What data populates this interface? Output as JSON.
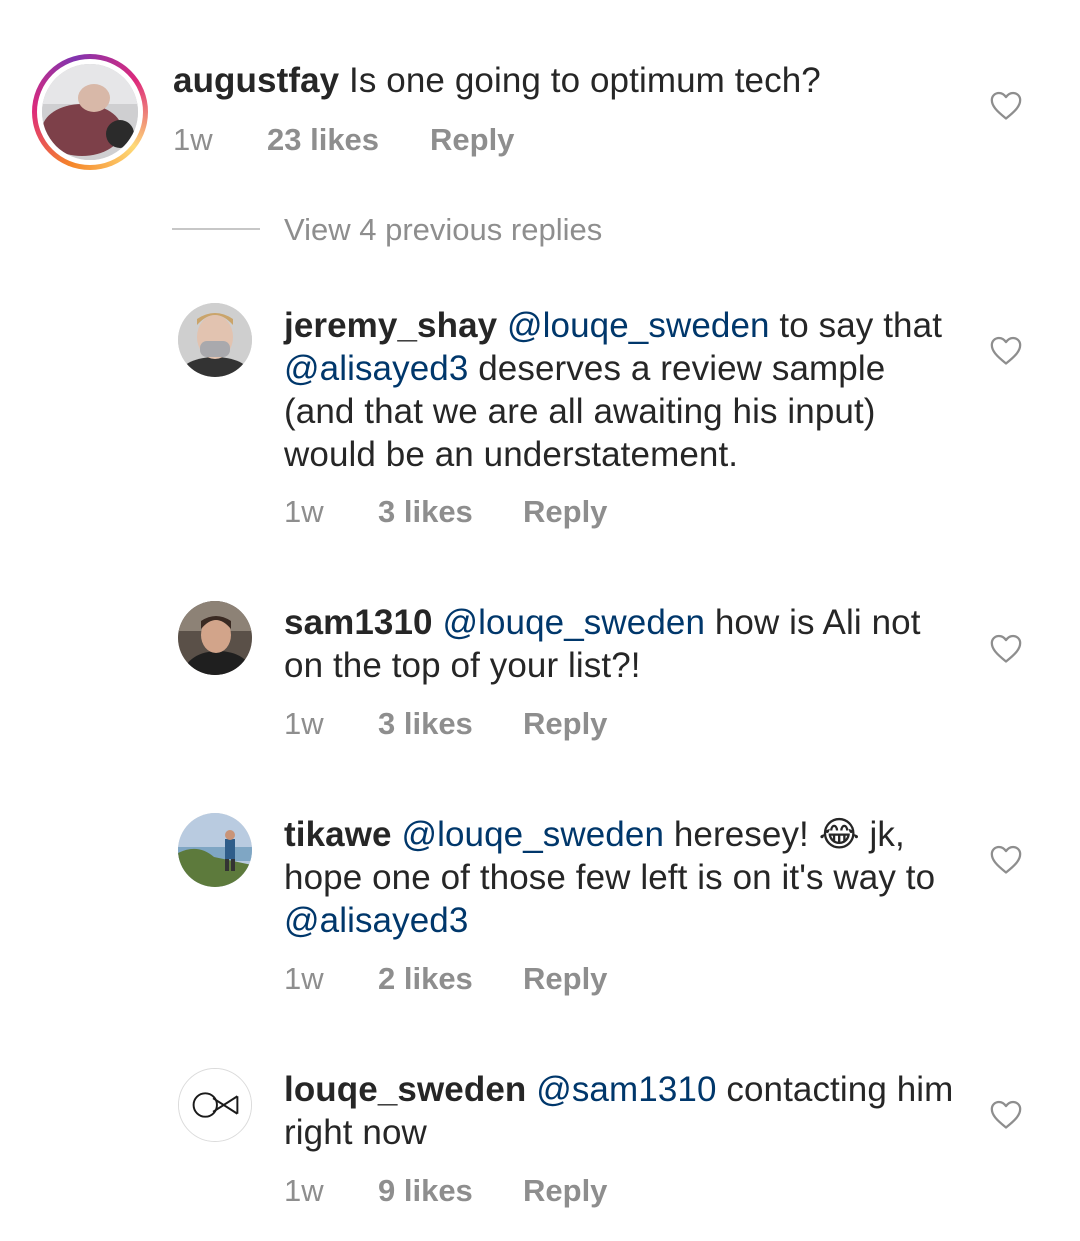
{
  "main_comment": {
    "username": "augustfay",
    "text": "Is one going to optimum tech?",
    "time": "1w",
    "likes": "23 likes",
    "reply_label": "Reply"
  },
  "view_replies_label": "View 4 previous replies",
  "replies": [
    {
      "username": "jeremy_shay",
      "segments": [
        {
          "type": "mention",
          "text": "@louqe_sweden"
        },
        {
          "type": "text",
          "text": " to say that "
        },
        {
          "type": "mention",
          "text": "@alisayed3"
        },
        {
          "type": "text",
          "text": "  deserves a review sample (and that we are all awaiting his input) would be an understatement."
        }
      ],
      "time": "1w",
      "likes": "3 likes",
      "reply_label": "Reply"
    },
    {
      "username": "sam1310",
      "segments": [
        {
          "type": "mention",
          "text": "@louqe_sweden"
        },
        {
          "type": "text",
          "text": " how is Ali not on the top of your list?!"
        }
      ],
      "time": "1w",
      "likes": "3 likes",
      "reply_label": "Reply"
    },
    {
      "username": "tikawe",
      "segments": [
        {
          "type": "mention",
          "text": "@louqe_sweden"
        },
        {
          "type": "text",
          "text": " heresey! 😂 jk, hope one of those few left is on it's way to "
        },
        {
          "type": "mention",
          "text": "@alisayed3"
        }
      ],
      "time": "1w",
      "likes": "2 likes",
      "reply_label": "Reply"
    },
    {
      "username": "louqe_sweden",
      "segments": [
        {
          "type": "mention",
          "text": "@sam1310"
        },
        {
          "type": "text",
          "text": " contacting him right now"
        }
      ],
      "time": "1w",
      "likes": "9 likes",
      "reply_label": "Reply"
    }
  ],
  "icons": {
    "like": "heart-outline-icon"
  },
  "colors": {
    "text": "#262626",
    "mention": "#00376b",
    "meta": "#8e8e8e"
  }
}
